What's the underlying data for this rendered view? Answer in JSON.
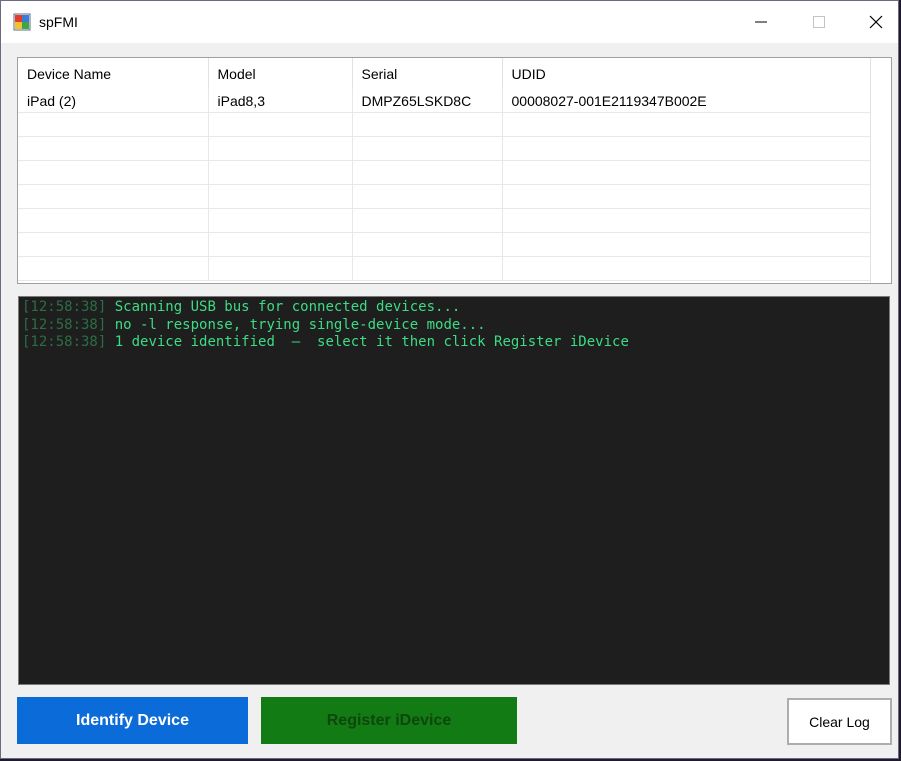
{
  "window": {
    "title": "spFMI"
  },
  "device_table": {
    "columns": [
      "Device Name",
      "Model",
      "Serial",
      "UDID"
    ],
    "rows": [
      [
        "iPad (2)",
        "iPad8,3",
        "DMPZ65LSKD8C",
        "00008027-001E2119347B002E"
      ]
    ]
  },
  "log": {
    "lines": [
      {
        "time": "[12:58:38]",
        "text": " Scanning USB bus for connected devices..."
      },
      {
        "time": "[12:58:38]",
        "text": " no -l response, trying single-device mode..."
      },
      {
        "time": "[12:58:38]",
        "text": " 1 device identified  —  select it then click Register iDevice"
      }
    ]
  },
  "buttons": {
    "identify_label": "Identify Device",
    "register_label": "Register iDevice",
    "clear_label": "Clear Log"
  },
  "colors": {
    "identify_bg": "#0b6bd8",
    "register_bg": "#137b13",
    "log_bg": "#1e1e1e",
    "log_text": "#3ddc84",
    "log_timestamp": "#2b6e45"
  },
  "icons": {
    "app": "app-window-icon",
    "minimize": "minimize-icon",
    "maximize": "maximize-icon",
    "close": "close-icon"
  }
}
